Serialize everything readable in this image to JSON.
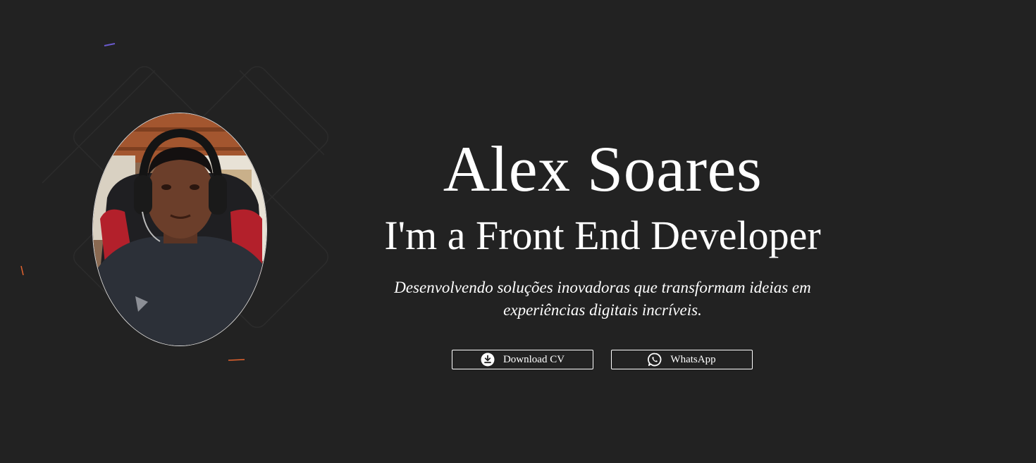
{
  "hero": {
    "name": "Alex Soares",
    "role": "I'm a Front End Developer",
    "tagline": "Desenvolvendo soluções inovadoras que transformam ideias em experiências digitais incríveis.",
    "avatar_alt": "Alex Soares"
  },
  "actions": {
    "download_cv": {
      "label": "Download CV",
      "icon": "download-icon"
    },
    "whatsapp": {
      "label": "WhatsApp",
      "icon": "whatsapp-icon"
    }
  },
  "theme": {
    "background": "#222222",
    "text": "#ffffff",
    "accent_orange": "#e5642e",
    "accent_purple": "#6a5acd"
  }
}
